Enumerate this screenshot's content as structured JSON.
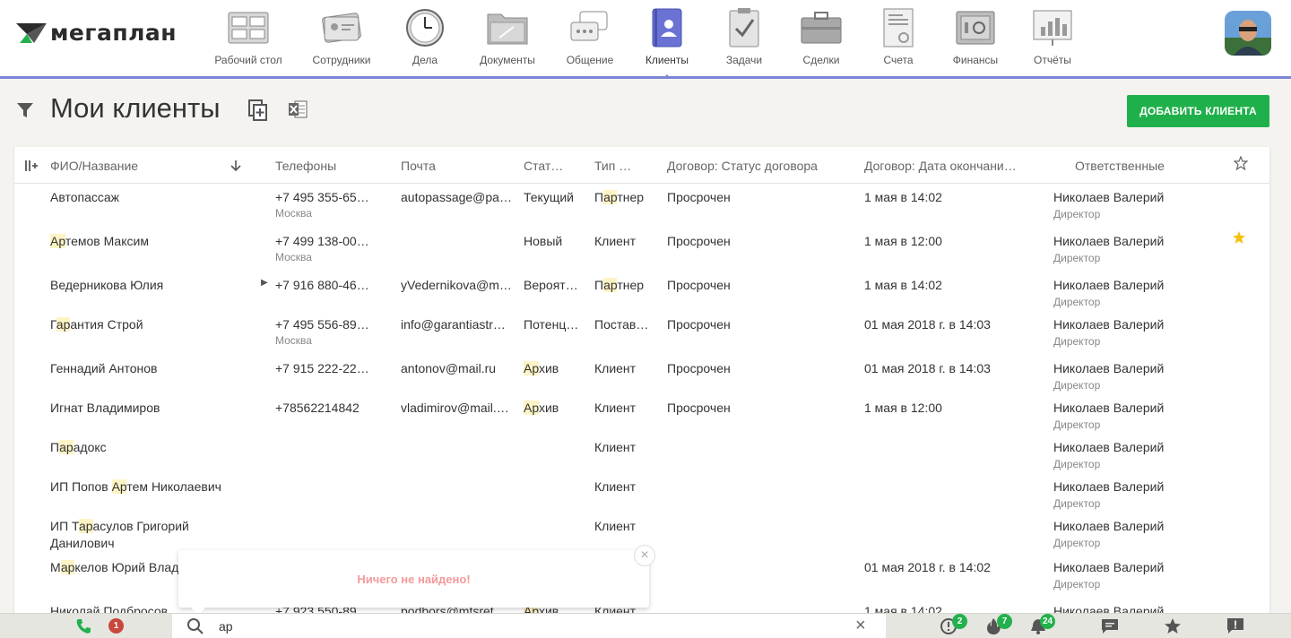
{
  "app": {
    "logo_text": "мегаплан"
  },
  "nav": [
    {
      "label": "Рабочий стол",
      "icon": "desktop-icon",
      "active": false
    },
    {
      "label": "Сотрудники",
      "icon": "employees-icon",
      "active": false
    },
    {
      "label": "Дела",
      "icon": "clock-icon",
      "active": false
    },
    {
      "label": "Документы",
      "icon": "folder-icon",
      "active": false
    },
    {
      "label": "Общение",
      "icon": "chat-icon",
      "active": false
    },
    {
      "label": "Клиенты",
      "icon": "clients-icon",
      "active": true
    },
    {
      "label": "Задачи",
      "icon": "clipboard-icon",
      "active": false
    },
    {
      "label": "Сделки",
      "icon": "briefcase-icon",
      "active": false
    },
    {
      "label": "Счета",
      "icon": "invoice-icon",
      "active": false
    },
    {
      "label": "Финансы",
      "icon": "safe-icon",
      "active": false
    },
    {
      "label": "Отчёты",
      "icon": "report-icon",
      "active": false
    }
  ],
  "page": {
    "title": "Мои клиенты",
    "add_button": "ДОБАВИТЬ КЛИЕНТА"
  },
  "table": {
    "headers": {
      "name": "ФИО/Название",
      "phones": "Телефоны",
      "email": "Почта",
      "status": "Стат…",
      "type": "Тип …",
      "contract_status": "Договор: Статус договора",
      "contract_end": "Договор: Дата окончани…",
      "responsible": "Ответственные"
    },
    "rows": [
      {
        "name": "Автопассаж",
        "phone": "+7 495 355-65…",
        "city": "Москва",
        "email": "autopassage@pa…",
        "status": "Текущий",
        "type": "Партнер",
        "contract_status": "Просрочен",
        "contract_end": "1 мая в 14:02",
        "responsible": "Николаев Валерий",
        "role": "Директор",
        "starred": false
      },
      {
        "name": "Артемов Максим",
        "phone": "+7 499 138-00…",
        "city": "Москва",
        "email": "",
        "status": "Новый",
        "type": "Клиент",
        "contract_status": "Просрочен",
        "contract_end": "1 мая в 12:00",
        "responsible": "Николаев Валерий",
        "role": "Директор",
        "starred": true
      },
      {
        "name": "Ведерникова Юлия",
        "phone": "+7 916 880-46…",
        "city": "",
        "email": "yVedernikova@m…",
        "status": "Вероят…",
        "type": "Партнер",
        "contract_status": "Просрочен",
        "contract_end": "1 мая в 14:02",
        "responsible": "Николаев Валерий",
        "role": "Директор",
        "starred": false
      },
      {
        "name": "Гарантия Строй",
        "phone": "+7 495 556-89…",
        "city": "Москва",
        "email": "info@garantiastr…",
        "status": "Потенц…",
        "type": "Постав…",
        "contract_status": "Просрочен",
        "contract_end": "01 мая 2018 г. в 14:03",
        "responsible": "Николаев Валерий",
        "role": "Директор",
        "starred": false
      },
      {
        "name": "Геннадий Антонов",
        "phone": "+7 915 222-22…",
        "city": "",
        "email": "antonov@mail.ru",
        "status": "Архив",
        "type": "Клиент",
        "contract_status": "Просрочен",
        "contract_end": "01 мая 2018 г. в 14:03",
        "responsible": "Николаев Валерий",
        "role": "Директор",
        "starred": false
      },
      {
        "name": "Игнат Владимиров",
        "phone": "+78562214842",
        "city": "",
        "email": "vladimirov@mail.…",
        "status": "Архив",
        "type": "Клиент",
        "contract_status": "Просрочен",
        "contract_end": "1 мая в 12:00",
        "responsible": "Николаев Валерий",
        "role": "Директор",
        "starred": false
      },
      {
        "name": "Парадокс",
        "phone": "",
        "city": "",
        "email": "",
        "status": "",
        "type": "Клиент",
        "contract_status": "",
        "contract_end": "",
        "responsible": "Николаев Валерий",
        "role": "Директор",
        "starred": false
      },
      {
        "name": "ИП Попов Артем Николаевич",
        "phone": "",
        "city": "",
        "email": "",
        "status": "",
        "type": "Клиент",
        "contract_status": "",
        "contract_end": "",
        "responsible": "Николаев Валерий",
        "role": "Директор",
        "starred": false
      },
      {
        "name": "ИП Тарасулов Григорий",
        "name2": "Данилович",
        "phone": "",
        "city": "",
        "email": "",
        "status": "",
        "type": "Клиент",
        "contract_status": "",
        "contract_end": "",
        "responsible": "Николаев Валерий",
        "role": "Директор",
        "starred": false
      },
      {
        "name": "Маркелов Юрий Влад",
        "phone": "",
        "city": "",
        "email": "",
        "status": "",
        "type": "",
        "contract_status": "",
        "contract_end": "01 мая 2018 г. в 14:02",
        "responsible": "Николаев Валерий",
        "role": "Директор",
        "starred": false
      },
      {
        "name": "Николай Подбросов",
        "phone": "+7 923 550-89",
        "city": "",
        "email": "podbors@mtsret",
        "status": "Архив",
        "type": "Клиент",
        "contract_status": "",
        "contract_end": "1 мая в 14:02",
        "responsible": "Николаев Валерий",
        "role": "",
        "starred": false
      }
    ]
  },
  "popup": {
    "message": "Ничего не найдено!",
    "close": "×"
  },
  "bottombar": {
    "phone_icon": "phone-icon",
    "notif_count": "1",
    "search_value": "ар",
    "clear": "×",
    "alerts_count": "2",
    "hot_count": "7",
    "bell_count": "24"
  },
  "colors": {
    "accent": "#7c86d6",
    "add_button": "#20b04b",
    "highlight": "#fdf4c5",
    "not_found": "#f39a9a",
    "star": "#f4c20d"
  }
}
